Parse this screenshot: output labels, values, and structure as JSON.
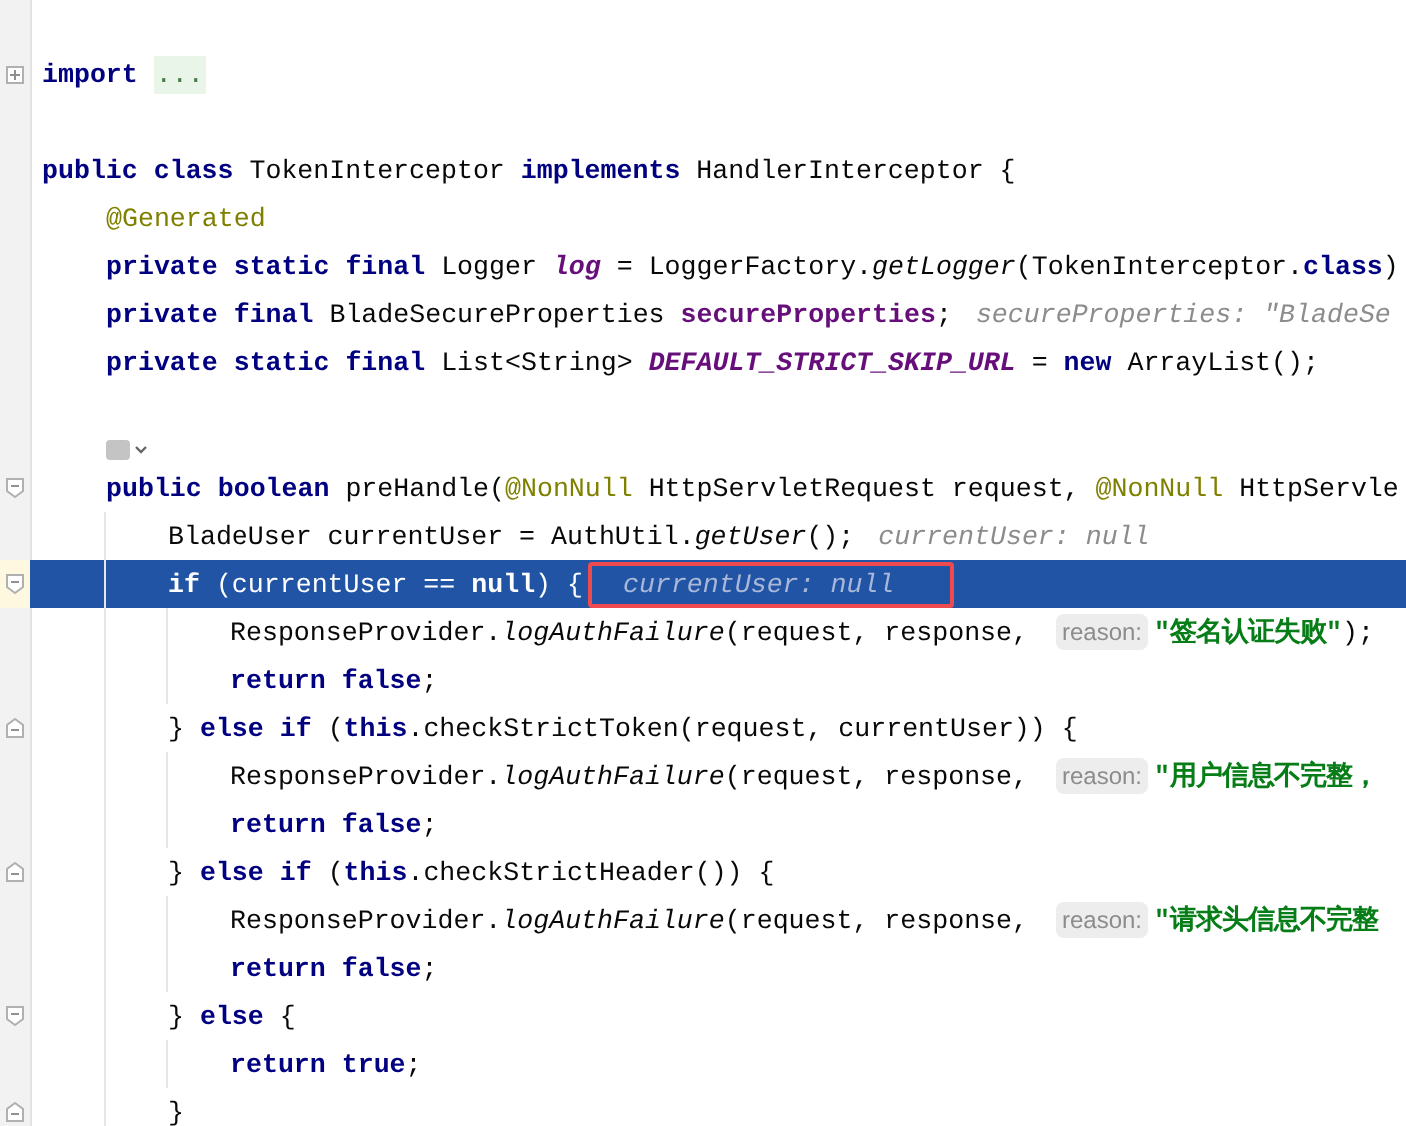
{
  "lines": [
    {
      "kind": "code",
      "selected": false,
      "fold": {
        "kind": "collapsed"
      },
      "tokens": [
        {
          "t": "import ",
          "kind": "kw"
        },
        {
          "t": "...",
          "kind": "folded"
        }
      ]
    },
    {
      "kind": "blank",
      "selected": false
    },
    {
      "kind": "code",
      "selected": false,
      "tokens": [
        {
          "t": "public class ",
          "kind": "kw"
        },
        {
          "t": "TokenInterceptor ",
          "kind": "plain"
        },
        {
          "t": "implements ",
          "kind": "kw"
        },
        {
          "t": "HandlerInterceptor {",
          "kind": "plain"
        }
      ],
      "children": [
        {
          "kind": "code",
          "selected": false,
          "tokens": [
            {
              "t": "@Generated",
              "kind": "ann"
            }
          ]
        },
        {
          "kind": "code",
          "selected": false,
          "tokens": [
            {
              "t": "private static final ",
              "kind": "kw"
            },
            {
              "t": "Logger ",
              "kind": "plain"
            },
            {
              "t": "log",
              "kind": "static"
            },
            {
              "t": " = LoggerFactory.",
              "kind": "plain"
            },
            {
              "t": "getLogger",
              "kind": "method"
            },
            {
              "t": "(TokenInterceptor.",
              "kind": "plain"
            },
            {
              "t": "class",
              "kind": "kw"
            },
            {
              "t": ")",
              "kind": "plain"
            }
          ]
        },
        {
          "kind": "code",
          "selected": false,
          "tokens": [
            {
              "t": "private final ",
              "kind": "kw"
            },
            {
              "t": "BladeSecureProperties ",
              "kind": "plain"
            },
            {
              "t": "secureProperties",
              "kind": "field"
            },
            {
              "t": ";",
              "kind": "plain"
            },
            {
              "t": "secureProperties: \"BladeSe",
              "kind": "hint",
              "outlined": false
            }
          ]
        },
        {
          "kind": "code",
          "selected": false,
          "tokens": [
            {
              "t": "private static final ",
              "kind": "kw"
            },
            {
              "t": "List<String> ",
              "kind": "plain"
            },
            {
              "t": "DEFAULT_STRICT_SKIP_URL",
              "kind": "static"
            },
            {
              "t": " = ",
              "kind": "plain"
            },
            {
              "t": "new ",
              "kind": "kw"
            },
            {
              "t": "ArrayList();",
              "kind": "plain"
            }
          ]
        },
        {
          "kind": "blank",
          "selected": false
        },
        {
          "kind": "inlay",
          "selected": false
        },
        {
          "kind": "code",
          "selected": false,
          "fold": {
            "kind": "start"
          },
          "tokens": [
            {
              "t": "public boolean ",
              "kind": "kw"
            },
            {
              "t": "preHandle(",
              "kind": "plain"
            },
            {
              "t": "@NonNull ",
              "kind": "ann"
            },
            {
              "t": "HttpServletRequest request, ",
              "kind": "plain"
            },
            {
              "t": "@NonNull ",
              "kind": "ann"
            },
            {
              "t": "HttpServle",
              "kind": "plain"
            }
          ],
          "children": [
            {
              "kind": "code",
              "selected": false,
              "tokens": [
                {
                  "t": "BladeUser currentUser = AuthUtil.",
                  "kind": "plain"
                },
                {
                  "t": "getUser",
                  "kind": "method"
                },
                {
                  "t": "();",
                  "kind": "plain"
                },
                {
                  "t": "currentUser: null",
                  "kind": "hint",
                  "outlined": false
                }
              ]
            },
            {
              "kind": "code",
              "selected": true,
              "fold": {
                "kind": "start"
              },
              "tokens": [
                {
                  "t": "if ",
                  "kind": "kw"
                },
                {
                  "t": "(currentUser == ",
                  "kind": "plain"
                },
                {
                  "t": "null",
                  "kind": "kw"
                },
                {
                  "t": ") {",
                  "kind": "plain"
                },
                {
                  "t": "currentUser: null",
                  "kind": "hint",
                  "outlined": true
                }
              ],
              "children": [
                {
                  "kind": "code",
                  "selected": false,
                  "tokens": [
                    {
                      "t": "ResponseProvider.",
                      "kind": "plain"
                    },
                    {
                      "t": "logAuthFailure",
                      "kind": "method"
                    },
                    {
                      "t": "(request, response, ",
                      "kind": "plain"
                    },
                    {
                      "t": "reason:",
                      "kind": "param"
                    },
                    {
                      "t": "\"签名认证失败\"",
                      "kind": "string"
                    },
                    {
                      "t": ");",
                      "kind": "plain"
                    }
                  ]
                },
                {
                  "kind": "code",
                  "selected": false,
                  "tokens": [
                    {
                      "t": "return false",
                      "kind": "kw"
                    },
                    {
                      "t": ";",
                      "kind": "plain"
                    }
                  ]
                }
              ]
            },
            {
              "kind": "code",
              "selected": false,
              "fold": {
                "kind": "end"
              },
              "tokens": [
                {
                  "t": "} ",
                  "kind": "plain"
                },
                {
                  "t": "else if ",
                  "kind": "kw"
                },
                {
                  "t": "(",
                  "kind": "plain"
                },
                {
                  "t": "this",
                  "kind": "kw"
                },
                {
                  "t": ".checkStrictToken(request, currentUser)) {",
                  "kind": "plain"
                }
              ],
              "children": [
                {
                  "kind": "code",
                  "selected": false,
                  "tokens": [
                    {
                      "t": "ResponseProvider.",
                      "kind": "plain"
                    },
                    {
                      "t": "logAuthFailure",
                      "kind": "method"
                    },
                    {
                      "t": "(request, response, ",
                      "kind": "plain"
                    },
                    {
                      "t": "reason:",
                      "kind": "param"
                    },
                    {
                      "t": "\"用户信息不完整，",
                      "kind": "string"
                    }
                  ]
                },
                {
                  "kind": "code",
                  "selected": false,
                  "tokens": [
                    {
                      "t": "return false",
                      "kind": "kw"
                    },
                    {
                      "t": ";",
                      "kind": "plain"
                    }
                  ]
                }
              ]
            },
            {
              "kind": "code",
              "selected": false,
              "fold": {
                "kind": "end"
              },
              "tokens": [
                {
                  "t": "} ",
                  "kind": "plain"
                },
                {
                  "t": "else if ",
                  "kind": "kw"
                },
                {
                  "t": "(",
                  "kind": "plain"
                },
                {
                  "t": "this",
                  "kind": "kw"
                },
                {
                  "t": ".checkStrictHeader()) {",
                  "kind": "plain"
                }
              ],
              "children": [
                {
                  "kind": "code",
                  "selected": false,
                  "tokens": [
                    {
                      "t": "ResponseProvider.",
                      "kind": "plain"
                    },
                    {
                      "t": "logAuthFailure",
                      "kind": "method"
                    },
                    {
                      "t": "(request, response, ",
                      "kind": "plain"
                    },
                    {
                      "t": "reason:",
                      "kind": "param"
                    },
                    {
                      "t": "\"请求头信息不完整",
                      "kind": "string"
                    }
                  ]
                },
                {
                  "kind": "code",
                  "selected": false,
                  "tokens": [
                    {
                      "t": "return false",
                      "kind": "kw"
                    },
                    {
                      "t": ";",
                      "kind": "plain"
                    }
                  ]
                }
              ]
            },
            {
              "kind": "code",
              "selected": false,
              "fold": {
                "kind": "start"
              },
              "tokens": [
                {
                  "t": "} ",
                  "kind": "plain"
                },
                {
                  "t": "else ",
                  "kind": "kw"
                },
                {
                  "t": "{",
                  "kind": "plain"
                }
              ],
              "children": [
                {
                  "kind": "code",
                  "selected": false,
                  "tokens": [
                    {
                      "t": "return true",
                      "kind": "kw"
                    },
                    {
                      "t": ";",
                      "kind": "plain"
                    }
                  ]
                }
              ]
            },
            {
              "kind": "code",
              "selected": false,
              "fold": {
                "kind": "end"
              },
              "tokens": [
                {
                  "t": "}",
                  "kind": "plain"
                }
              ]
            }
          ]
        }
      ]
    }
  ]
}
